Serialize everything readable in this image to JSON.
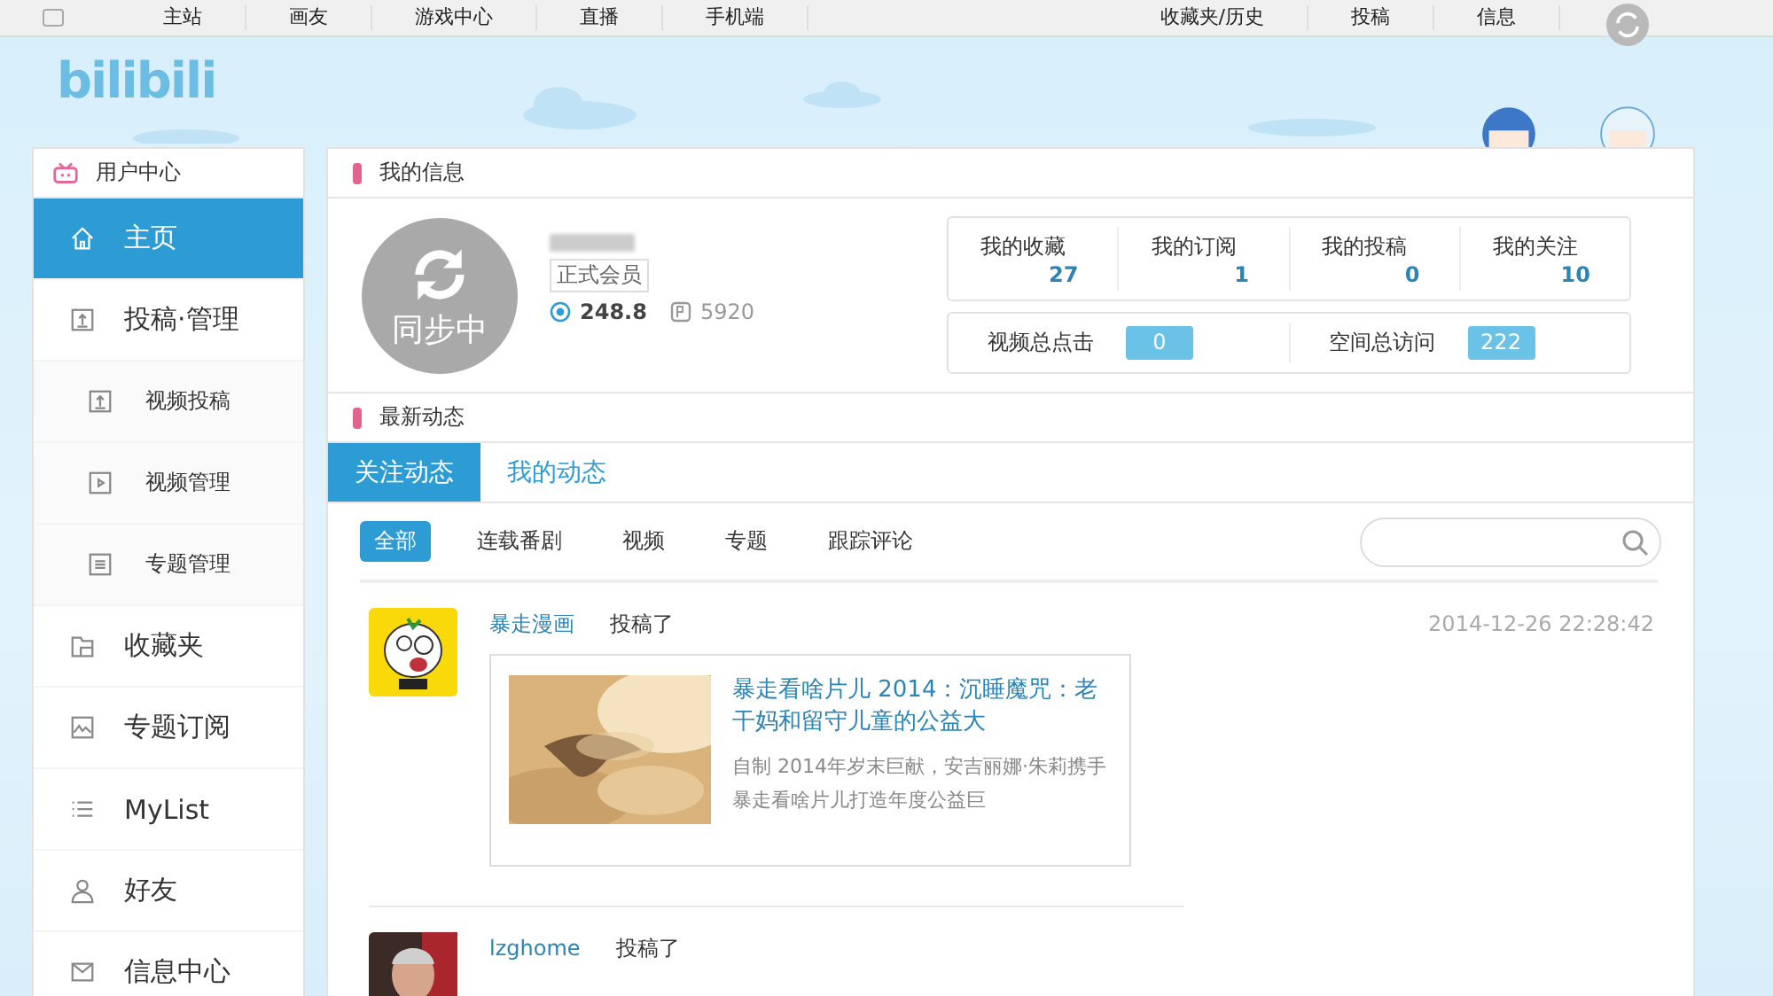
{
  "top_nav": {
    "left": [
      "主站",
      "画友",
      "游戏中心",
      "直播",
      "手机端"
    ],
    "right": [
      "收藏夹/历史",
      "投稿",
      "信息"
    ]
  },
  "logo": "bilibili",
  "sidebar": {
    "title": "用户中心",
    "items": [
      {
        "label": "主页",
        "kind": "main",
        "selected": true
      },
      {
        "label": "投稿·管理",
        "kind": "main",
        "selected": false
      },
      {
        "label": "视频投稿",
        "kind": "sub",
        "selected": false
      },
      {
        "label": "视频管理",
        "kind": "sub",
        "selected": false
      },
      {
        "label": "专题管理",
        "kind": "sub",
        "selected": false
      },
      {
        "label": "收藏夹",
        "kind": "main",
        "selected": false
      },
      {
        "label": "专题订阅",
        "kind": "main",
        "selected": false
      },
      {
        "label": "MyList",
        "kind": "main",
        "selected": false
      },
      {
        "label": "好友",
        "kind": "main",
        "selected": false
      },
      {
        "label": "信息中心",
        "kind": "main",
        "selected": false
      }
    ]
  },
  "my_info": {
    "title": "我的信息",
    "avatar_caption": "同步中",
    "member_badge": "正式会员",
    "coins": "248.8",
    "points": "5920",
    "stats": [
      {
        "label": "我的收藏",
        "value": "27"
      },
      {
        "label": "我的订阅",
        "value": "1"
      },
      {
        "label": "我的投稿",
        "value": "0"
      },
      {
        "label": "我的关注",
        "value": "10"
      }
    ],
    "totals": [
      {
        "label": "视频总点击",
        "value": "0"
      },
      {
        "label": "空间总访问",
        "value": "222"
      }
    ]
  },
  "feed": {
    "title": "最新动态",
    "tabs": [
      {
        "label": "关注动态",
        "selected": true
      },
      {
        "label": "我的动态",
        "selected": false
      }
    ],
    "filters": [
      {
        "label": "全部",
        "selected": true
      },
      {
        "label": "连载番剧",
        "selected": false
      },
      {
        "label": "视频",
        "selected": false
      },
      {
        "label": "专题",
        "selected": false
      },
      {
        "label": "跟踪评论",
        "selected": false
      }
    ],
    "items": [
      {
        "user": "暴走漫画",
        "action": "投稿了",
        "time": "2014-12-26 22:28:42",
        "card": {
          "title": "暴走看啥片儿 2014：沉睡魔咒：老干妈和留守儿童的公益大",
          "description": "自制 2014年岁末巨献，安吉丽娜·朱莉携手暴走看啥片儿打造年度公益巨"
        }
      },
      {
        "user": "lzghome",
        "action": "投稿了"
      }
    ]
  }
}
